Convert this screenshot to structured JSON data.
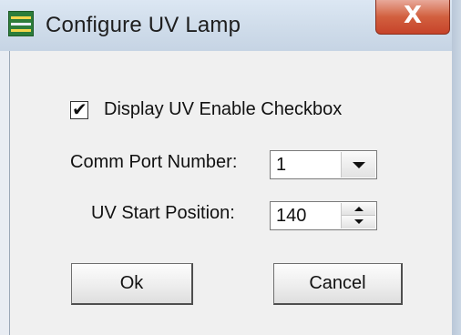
{
  "window": {
    "title": "Configure UV Lamp",
    "close_glyph": "X",
    "icon": "app-logo-icon"
  },
  "form": {
    "display_uv_checkbox": {
      "label": "Display UV Enable Checkbox",
      "checked": true,
      "check_glyph": "✔"
    },
    "comm_port": {
      "label": "Comm Port Number:",
      "value": "1"
    },
    "uv_start": {
      "label": "UV Start Position:",
      "value": "140"
    }
  },
  "buttons": {
    "ok": "Ok",
    "cancel": "Cancel"
  },
  "colors": {
    "close_button": "#c6432a",
    "title_bar": "#cfdcea",
    "client_bg": "#f0f0f0"
  }
}
